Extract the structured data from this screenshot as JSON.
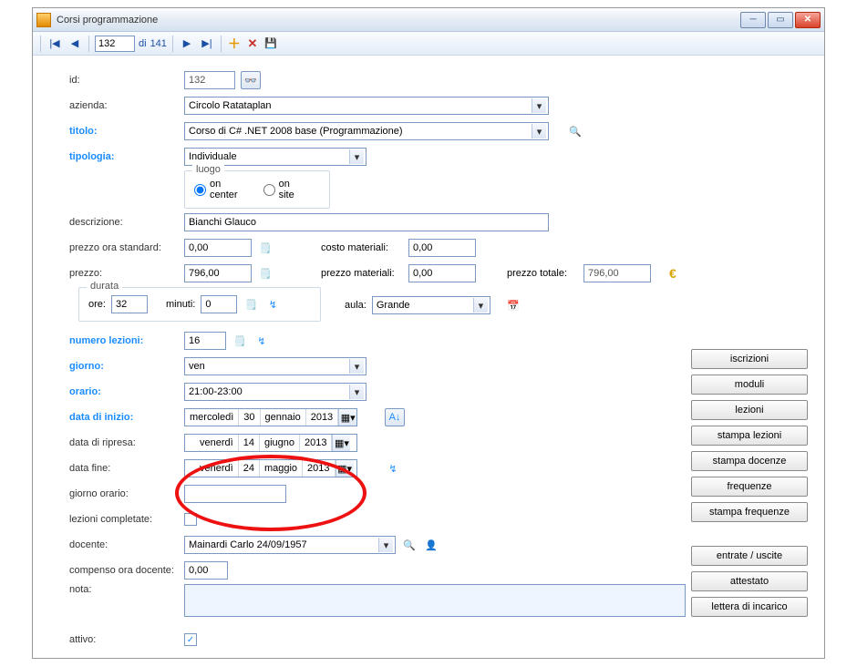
{
  "window": {
    "title": "Corsi programmazione"
  },
  "nav": {
    "current": "132",
    "total_prefix": "di",
    "total": "141"
  },
  "labels": {
    "id": "id:",
    "azienda": "azienda:",
    "titolo": "titolo:",
    "tipologia": "tipologia:",
    "luogo": "luogo",
    "on_center": "on center",
    "on_site": "on site",
    "descrizione": "descrizione:",
    "prezzo_ora_standard": "prezzo ora standard:",
    "costo_materiali": "costo materiali:",
    "prezzo": "prezzo:",
    "prezzo_materiali": "prezzo materiali:",
    "prezzo_totale": "prezzo totale:",
    "durata": "durata",
    "ore": "ore:",
    "minuti": "minuti:",
    "aula": "aula:",
    "numero_lezioni": "numero lezioni:",
    "giorno": "giorno:",
    "orario": "orario:",
    "data_inizio": "data di inizio:",
    "data_ripresa": "data di ripresa:",
    "data_fine": "data fine:",
    "giorno_orario": "giorno orario:",
    "lezioni_completate": "lezioni completate:",
    "docente": "docente:",
    "compenso_ora_docente": "compenso ora docente:",
    "nota": "nota:",
    "attivo": "attivo:"
  },
  "values": {
    "id": "132",
    "azienda": "Circolo Ratataplan",
    "titolo": "Corso di C# .NET 2008 base (Programmazione)",
    "tipologia": "Individuale",
    "descrizione": "Bianchi Glauco",
    "prezzo_ora_standard": "0,00",
    "costo_materiali": "0,00",
    "prezzo": "796,00",
    "prezzo_materiali": "0,00",
    "prezzo_totale": "796,00",
    "ore": "32",
    "minuti": "0",
    "aula": "Grande",
    "numero_lezioni": "16",
    "giorno": "ven",
    "orario": "21:00-23:00",
    "docente": "Mainardi Carlo 24/09/1957",
    "compenso_ora_docente": "0,00",
    "attivo_checked": "✓"
  },
  "dates": {
    "inizio": {
      "dow": "mercoledì",
      "day": "30",
      "month": "gennaio",
      "year": "2013"
    },
    "ripresa": {
      "dow": "venerdì",
      "day": "14",
      "month": "giugno",
      "year": "2013"
    },
    "fine": {
      "dow": "venerdì",
      "day": "24",
      "month": "maggio",
      "year": "2013"
    }
  },
  "buttons": {
    "iscrizioni": "iscrizioni",
    "moduli": "moduli",
    "lezioni": "lezioni",
    "stampa_lezioni": "stampa lezioni",
    "stampa_docenze": "stampa docenze",
    "frequenze": "frequenze",
    "stampa_frequenze": "stampa frequenze",
    "entrate_uscite": "entrate / uscite",
    "attestato": "attestato",
    "lettera_incarico": "lettera di incarico"
  }
}
